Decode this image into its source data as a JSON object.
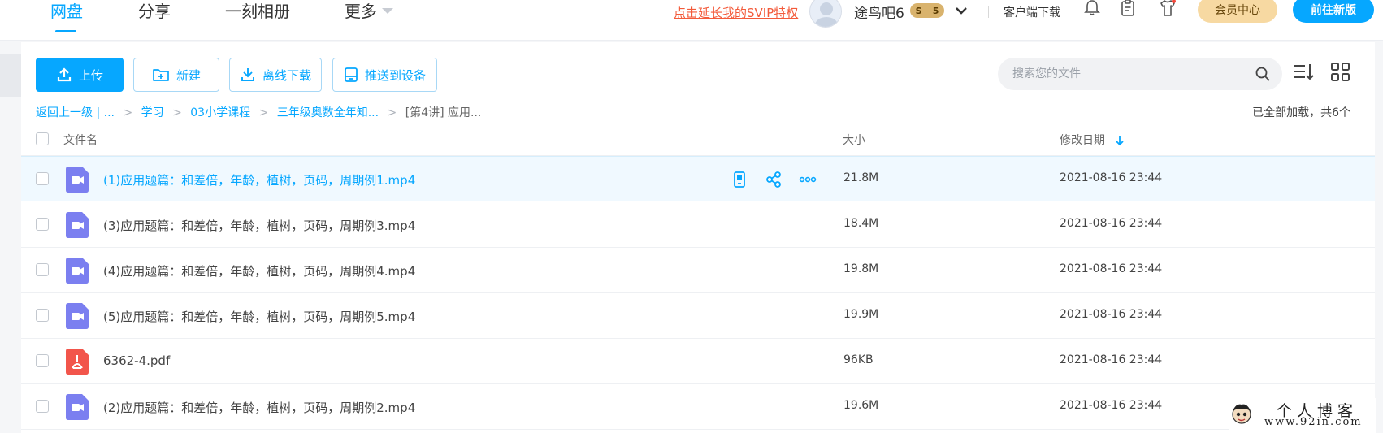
{
  "nav": {
    "tabs": [
      {
        "label": "网盘"
      },
      {
        "label": "分享"
      },
      {
        "label": "一刻相册"
      },
      {
        "label": "更多"
      }
    ]
  },
  "header": {
    "svip_link": "点击延长我的SVIP特权",
    "username": "途鸟吧6",
    "vip_level_a": "S",
    "vip_level_b": "5",
    "client_download": "客户端下载",
    "vip_center": "会员中心",
    "new_version": "前往新版",
    "icons": [
      "bell-icon",
      "clipboard-icon",
      "shirt-icon"
    ],
    "accent_color": "#06a7ff"
  },
  "toolbar": {
    "upload": "上传",
    "new": "新建",
    "offline_download": "离线下载",
    "push_device": "推送到设备",
    "search_placeholder": "搜索您的文件"
  },
  "breadcrumb": {
    "back": "返回上一级",
    "ellipsis": "|  ...",
    "items": [
      "学习",
      "03小学课程",
      "三年级奥数全年知..."
    ],
    "current": "[第4讲] 应用..."
  },
  "status": {
    "loaded": "已全部加载，共6个"
  },
  "table": {
    "headers": {
      "name": "文件名",
      "size": "大小",
      "date": "修改日期"
    },
    "rows": [
      {
        "name": "(1)应用题篇：和差倍，年龄，植树，页码，周期例1.mp4",
        "size": "21.8M",
        "date": "2021-08-16 23:44",
        "type": "video"
      },
      {
        "name": "(3)应用题篇：和差倍，年龄，植树，页码，周期例3.mp4",
        "size": "18.4M",
        "date": "2021-08-16 23:44",
        "type": "video"
      },
      {
        "name": "(4)应用题篇：和差倍，年龄，植树，页码，周期例4.mp4",
        "size": "19.8M",
        "date": "2021-08-16 23:44",
        "type": "video"
      },
      {
        "name": "(5)应用题篇：和差倍，年龄，植树，页码，周期例5.mp4",
        "size": "19.9M",
        "date": "2021-08-16 23:44",
        "type": "video"
      },
      {
        "name": "6362-4.pdf",
        "size": "96KB",
        "date": "2021-08-16 23:44",
        "type": "pdf"
      },
      {
        "name": "(2)应用题篇：和差倍，年龄，植树，页码，周期例2.mp4",
        "size": "19.6M",
        "date": "2021-08-16 23:44",
        "type": "video"
      }
    ]
  },
  "watermark": {
    "title": "个人博客",
    "url": "www.92in.com"
  }
}
